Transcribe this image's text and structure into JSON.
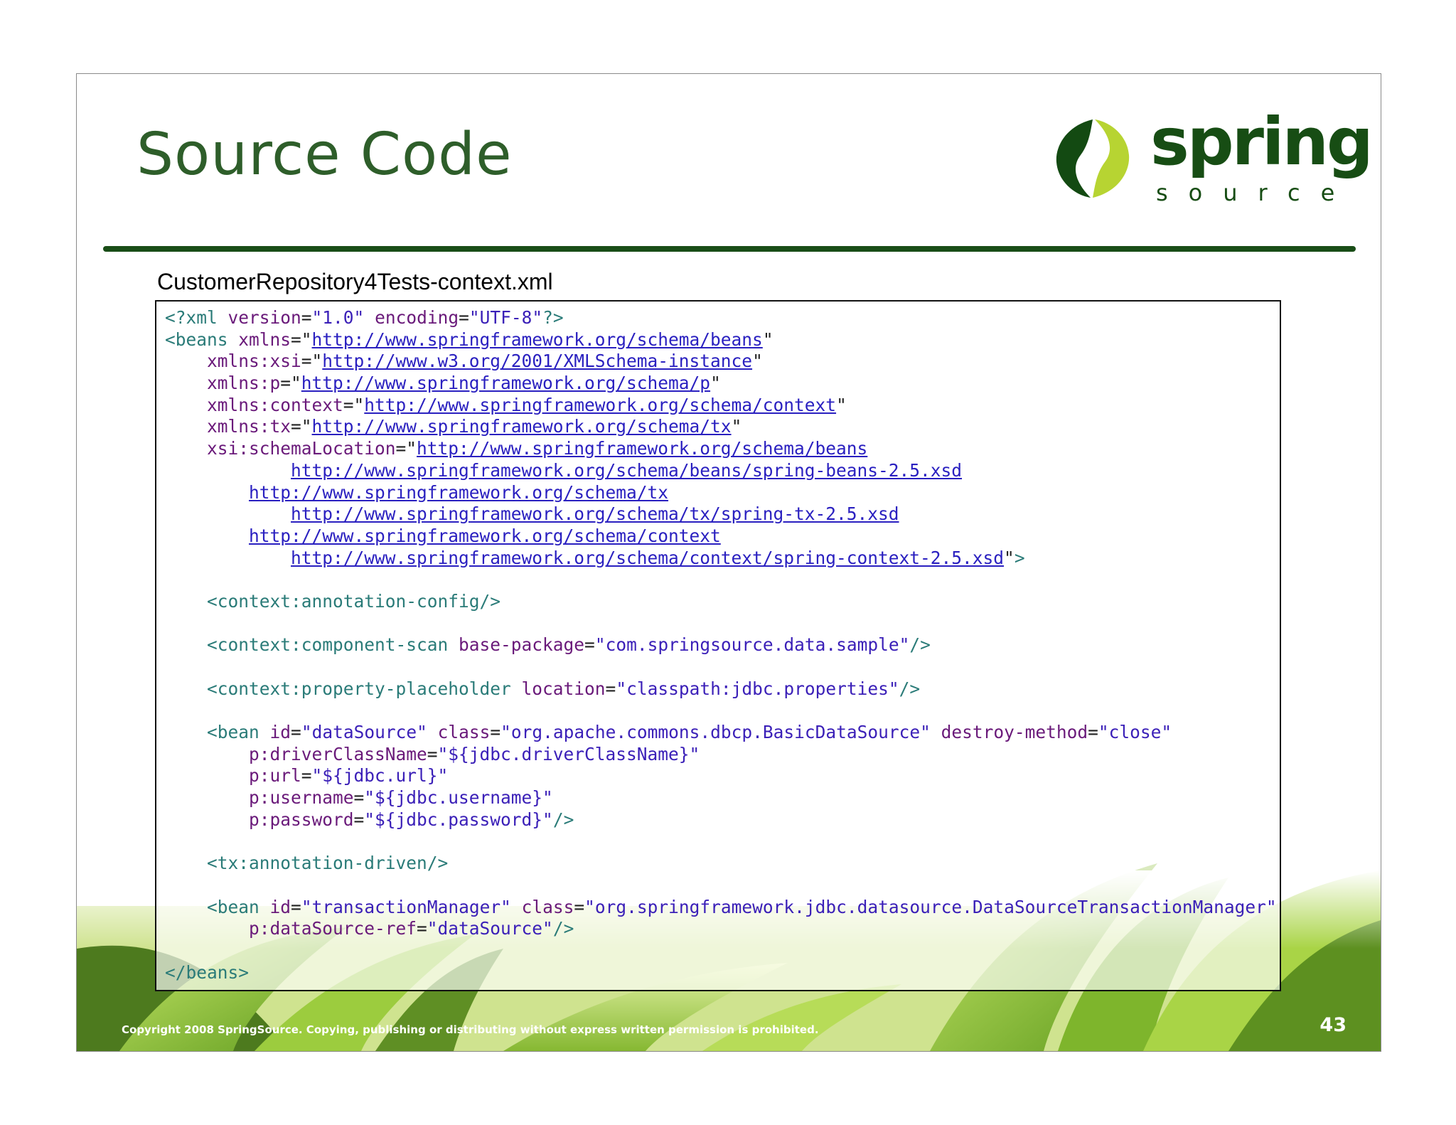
{
  "slide": {
    "title": "Source Code",
    "logo": {
      "word": "spring",
      "sub": "source",
      "icon": "spring-leaf-icon"
    },
    "file_title": "CustomerRepository4Tests-context.xml",
    "footer": "Copyright 2008 SpringSource.  Copying, publishing or distributing without express written permission is prohibited.",
    "page_number": "43",
    "colors": {
      "title": "#2e5e2a",
      "rule": "#194d17",
      "tag": "#2a7b78",
      "attr": "#6a1a7a",
      "value": "#3b20b8",
      "url": "#2a20c0"
    }
  },
  "code": [
    [
      [
        "t",
        "<?xml "
      ],
      [
        "a",
        "version"
      ],
      [
        "p",
        "="
      ],
      [
        "v",
        "\"1.0\" "
      ],
      [
        "a",
        "encoding"
      ],
      [
        "p",
        "="
      ],
      [
        "v",
        "\"UTF-8\""
      ],
      [
        "t",
        "?>"
      ]
    ],
    [
      [
        "t",
        "<beans "
      ],
      [
        "a",
        "xmlns"
      ],
      [
        "p",
        "=\""
      ],
      [
        "u",
        "http://www.springframework.org/schema/beans"
      ],
      [
        "p",
        "\""
      ]
    ],
    [
      [
        "p",
        "    "
      ],
      [
        "a",
        "xmlns:xsi"
      ],
      [
        "p",
        "=\""
      ],
      [
        "u",
        "http://www.w3.org/2001/XMLSchema-instance"
      ],
      [
        "p",
        "\""
      ]
    ],
    [
      [
        "p",
        "    "
      ],
      [
        "a",
        "xmlns:p"
      ],
      [
        "p",
        "=\""
      ],
      [
        "u",
        "http://www.springframework.org/schema/p"
      ],
      [
        "p",
        "\""
      ]
    ],
    [
      [
        "p",
        "    "
      ],
      [
        "a",
        "xmlns:context"
      ],
      [
        "p",
        "=\""
      ],
      [
        "u",
        "http://www.springframework.org/schema/context"
      ],
      [
        "p",
        "\""
      ]
    ],
    [
      [
        "p",
        "    "
      ],
      [
        "a",
        "xmlns:tx"
      ],
      [
        "p",
        "=\""
      ],
      [
        "u",
        "http://www.springframework.org/schema/tx"
      ],
      [
        "p",
        "\""
      ]
    ],
    [
      [
        "p",
        "    "
      ],
      [
        "a",
        "xsi:schemaLocation"
      ],
      [
        "p",
        "=\""
      ],
      [
        "u",
        "http://www.springframework.org/schema/beans"
      ]
    ],
    [
      [
        "p",
        "            "
      ],
      [
        "u",
        "http://www.springframework.org/schema/beans/spring-beans-2.5.xsd"
      ]
    ],
    [
      [
        "p",
        "        "
      ],
      [
        "u",
        "http://www.springframework.org/schema/tx"
      ]
    ],
    [
      [
        "p",
        "            "
      ],
      [
        "u",
        "http://www.springframework.org/schema/tx/spring-tx-2.5.xsd"
      ]
    ],
    [
      [
        "p",
        "        "
      ],
      [
        "u",
        "http://www.springframework.org/schema/context"
      ]
    ],
    [
      [
        "p",
        "            "
      ],
      [
        "u",
        "http://www.springframework.org/schema/context/spring-context-2.5.xsd"
      ],
      [
        "p",
        "\""
      ],
      [
        "t",
        ">"
      ]
    ],
    [],
    [
      [
        "p",
        "    "
      ],
      [
        "t",
        "<context:annotation-config/>"
      ]
    ],
    [],
    [
      [
        "p",
        "    "
      ],
      [
        "t",
        "<context:component-scan "
      ],
      [
        "a",
        "base-package"
      ],
      [
        "p",
        "="
      ],
      [
        "v",
        "\"com.springsource.data.sample\""
      ],
      [
        "t",
        "/>"
      ]
    ],
    [],
    [
      [
        "p",
        "    "
      ],
      [
        "t",
        "<context:property-placeholder "
      ],
      [
        "a",
        "location"
      ],
      [
        "p",
        "="
      ],
      [
        "v",
        "\"classpath:jdbc.properties\""
      ],
      [
        "t",
        "/>"
      ]
    ],
    [],
    [
      [
        "p",
        "    "
      ],
      [
        "t",
        "<bean "
      ],
      [
        "a",
        "id"
      ],
      [
        "p",
        "="
      ],
      [
        "v",
        "\"dataSource\" "
      ],
      [
        "a",
        "class"
      ],
      [
        "p",
        "="
      ],
      [
        "v",
        "\"org.apache.commons.dbcp.BasicDataSource\" "
      ],
      [
        "a",
        "destroy-method"
      ],
      [
        "p",
        "="
      ],
      [
        "v",
        "\"close\""
      ]
    ],
    [
      [
        "p",
        "        "
      ],
      [
        "a",
        "p:driverClassName"
      ],
      [
        "p",
        "="
      ],
      [
        "v",
        "\"${jdbc.driverClassName}\""
      ]
    ],
    [
      [
        "p",
        "        "
      ],
      [
        "a",
        "p:url"
      ],
      [
        "p",
        "="
      ],
      [
        "v",
        "\"${jdbc.url}\""
      ]
    ],
    [
      [
        "p",
        "        "
      ],
      [
        "a",
        "p:username"
      ],
      [
        "p",
        "="
      ],
      [
        "v",
        "\"${jdbc.username}\""
      ]
    ],
    [
      [
        "p",
        "        "
      ],
      [
        "a",
        "p:password"
      ],
      [
        "p",
        "="
      ],
      [
        "v",
        "\"${jdbc.password}\""
      ],
      [
        "t",
        "/>"
      ]
    ],
    [],
    [
      [
        "p",
        "    "
      ],
      [
        "t",
        "<tx:annotation-driven/>"
      ]
    ],
    [],
    [
      [
        "p",
        "    "
      ],
      [
        "t",
        "<bean "
      ],
      [
        "a",
        "id"
      ],
      [
        "p",
        "="
      ],
      [
        "v",
        "\"transactionManager\" "
      ],
      [
        "a",
        "class"
      ],
      [
        "p",
        "="
      ],
      [
        "v",
        "\"org.springframework.jdbc.datasource.DataSourceTransactionManager\""
      ]
    ],
    [
      [
        "p",
        "        "
      ],
      [
        "a",
        "p:dataSource-ref"
      ],
      [
        "p",
        "="
      ],
      [
        "v",
        "\"dataSource\""
      ],
      [
        "t",
        "/>"
      ]
    ],
    [],
    [
      [
        "t",
        "</beans>"
      ]
    ]
  ]
}
